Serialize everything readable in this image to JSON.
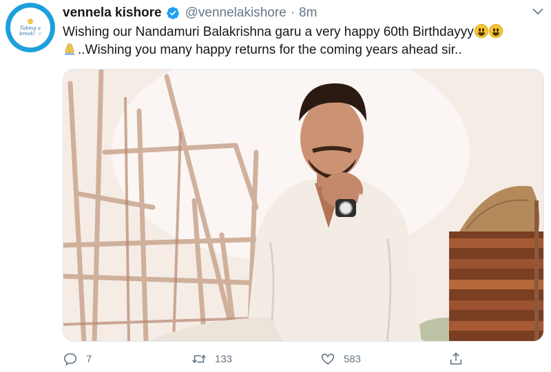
{
  "tweet": {
    "display_name": "vennela kishore",
    "handle": "@vennelakishore",
    "separator": "·",
    "time": "8m",
    "text_line1": "Wishing our Nandamuri Balakrishna garu a very happy 60th Birthdayyy",
    "text_line2": "..Wishing you many happy returns for the coming years ahead sir..",
    "avatar_text": "Taking a break! ☆"
  },
  "actions": {
    "reply_count": "7",
    "retweet_count": "133",
    "like_count": "583"
  },
  "colors": {
    "brand": "#1da1f2",
    "text_secondary": "#657786"
  },
  "icons": [
    "verified-badge-icon",
    "chevron-down-icon",
    "smiley-emoji-icon",
    "folded-hands-emoji-icon",
    "reply-icon",
    "retweet-icon",
    "like-icon",
    "share-icon"
  ]
}
